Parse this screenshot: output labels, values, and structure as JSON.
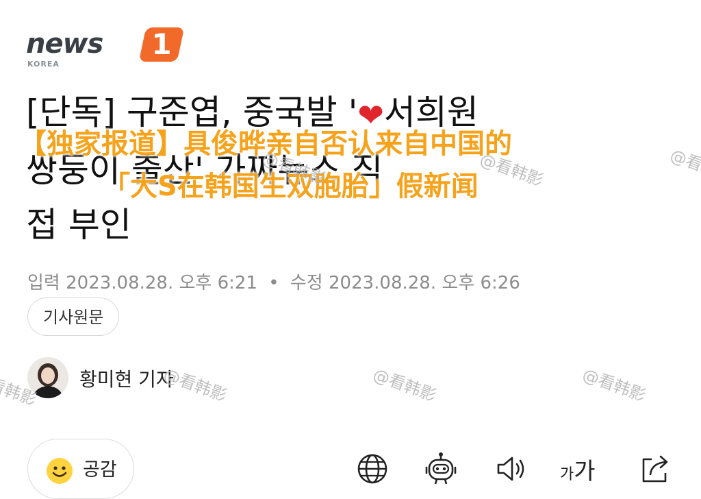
{
  "logo": {
    "wordmark": "news",
    "badge": "1",
    "region": "KOREA"
  },
  "headline": {
    "line1_a": "[단독] 구준엽, 중국발 '",
    "line1_b": "서희원",
    "line2": "쌍둥이 출산' 가짜뉴스 직",
    "line3": "접 부인"
  },
  "caption": {
    "line1": "【独家报道】具俊晔亲自否认来自中国的",
    "line2": "「大S在韩国生双胞胎」假新闻"
  },
  "meta": {
    "published_label": "입력",
    "published": "2023.08.28. 오후 6:21",
    "separator": "•",
    "modified_label": "수정",
    "modified": "2023.08.28. 오후 6:26"
  },
  "source_button": "기사원문",
  "reporter": "황미현 기자",
  "actions": {
    "like_label": "공감",
    "font_small": "가",
    "font_large": "가"
  },
  "watermark": "@看韩影",
  "colors": {
    "logo_orange": "#f26a2a",
    "caption_orange": "#f6a21a",
    "heart_red": "#e0262c",
    "meta_gray": "#8c8c8c"
  },
  "icons": [
    "heart-icon",
    "smile-icon",
    "globe-icon",
    "robot-icon",
    "speaker-icon",
    "font-size-icon",
    "share-icon"
  ]
}
